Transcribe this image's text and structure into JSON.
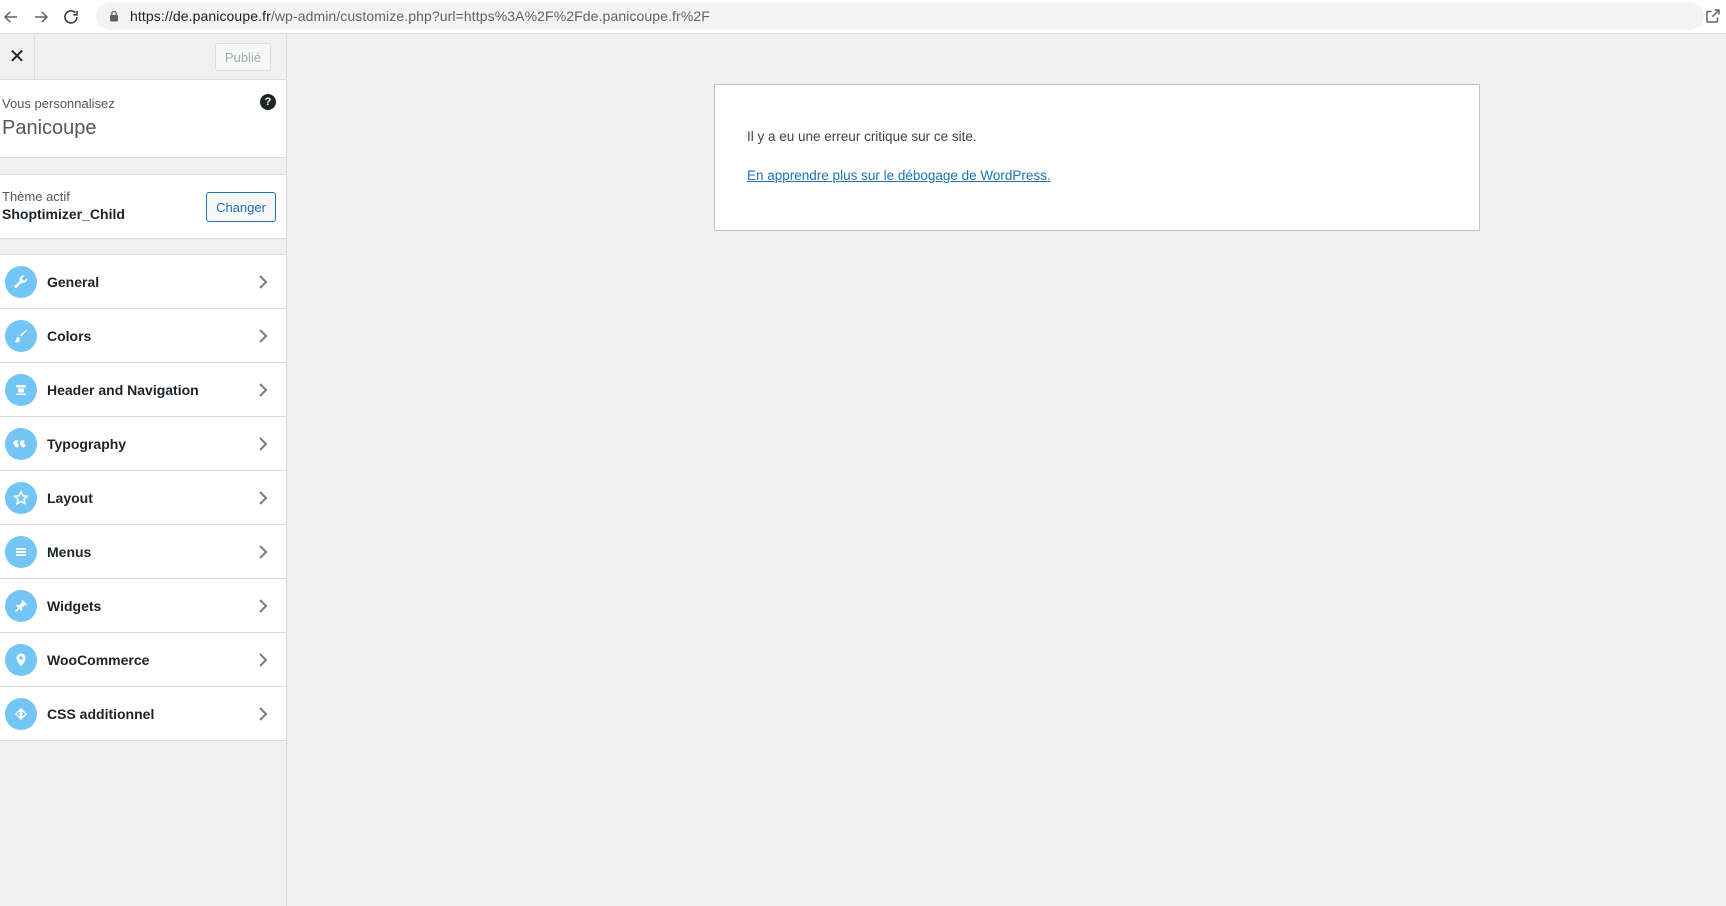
{
  "browser": {
    "url_host": "https://de.panicoupe.fr",
    "url_path": "/wp-admin/customize.php?url=https%3A%2F%2Fde.panicoupe.fr%2F"
  },
  "customizer": {
    "publish_label": "Publié",
    "customizing_label": "Vous personnalisez",
    "site_title": "Panicoupe",
    "active_theme_label": "Thème actif",
    "theme_name": "Shoptimizer_Child",
    "change_label": "Changer",
    "panels": [
      {
        "label": "General",
        "icon": "wrench-icon"
      },
      {
        "label": "Colors",
        "icon": "brush-icon"
      },
      {
        "label": "Header and Navigation",
        "icon": "header-icon"
      },
      {
        "label": "Typography",
        "icon": "quote-icon"
      },
      {
        "label": "Layout",
        "icon": "star-icon"
      },
      {
        "label": "Menus",
        "icon": "menu-icon"
      },
      {
        "label": "Widgets",
        "icon": "pin-icon"
      },
      {
        "label": "WooCommerce",
        "icon": "location-icon"
      },
      {
        "label": "CSS additionnel",
        "icon": "code-icon"
      }
    ],
    "icon_color": "#72c5f5"
  },
  "preview": {
    "error_message": "Il y a eu une erreur critique sur ce site.",
    "error_link": "En apprendre plus sur le débogage de WordPress.",
    "link_color": "#2271b1"
  }
}
